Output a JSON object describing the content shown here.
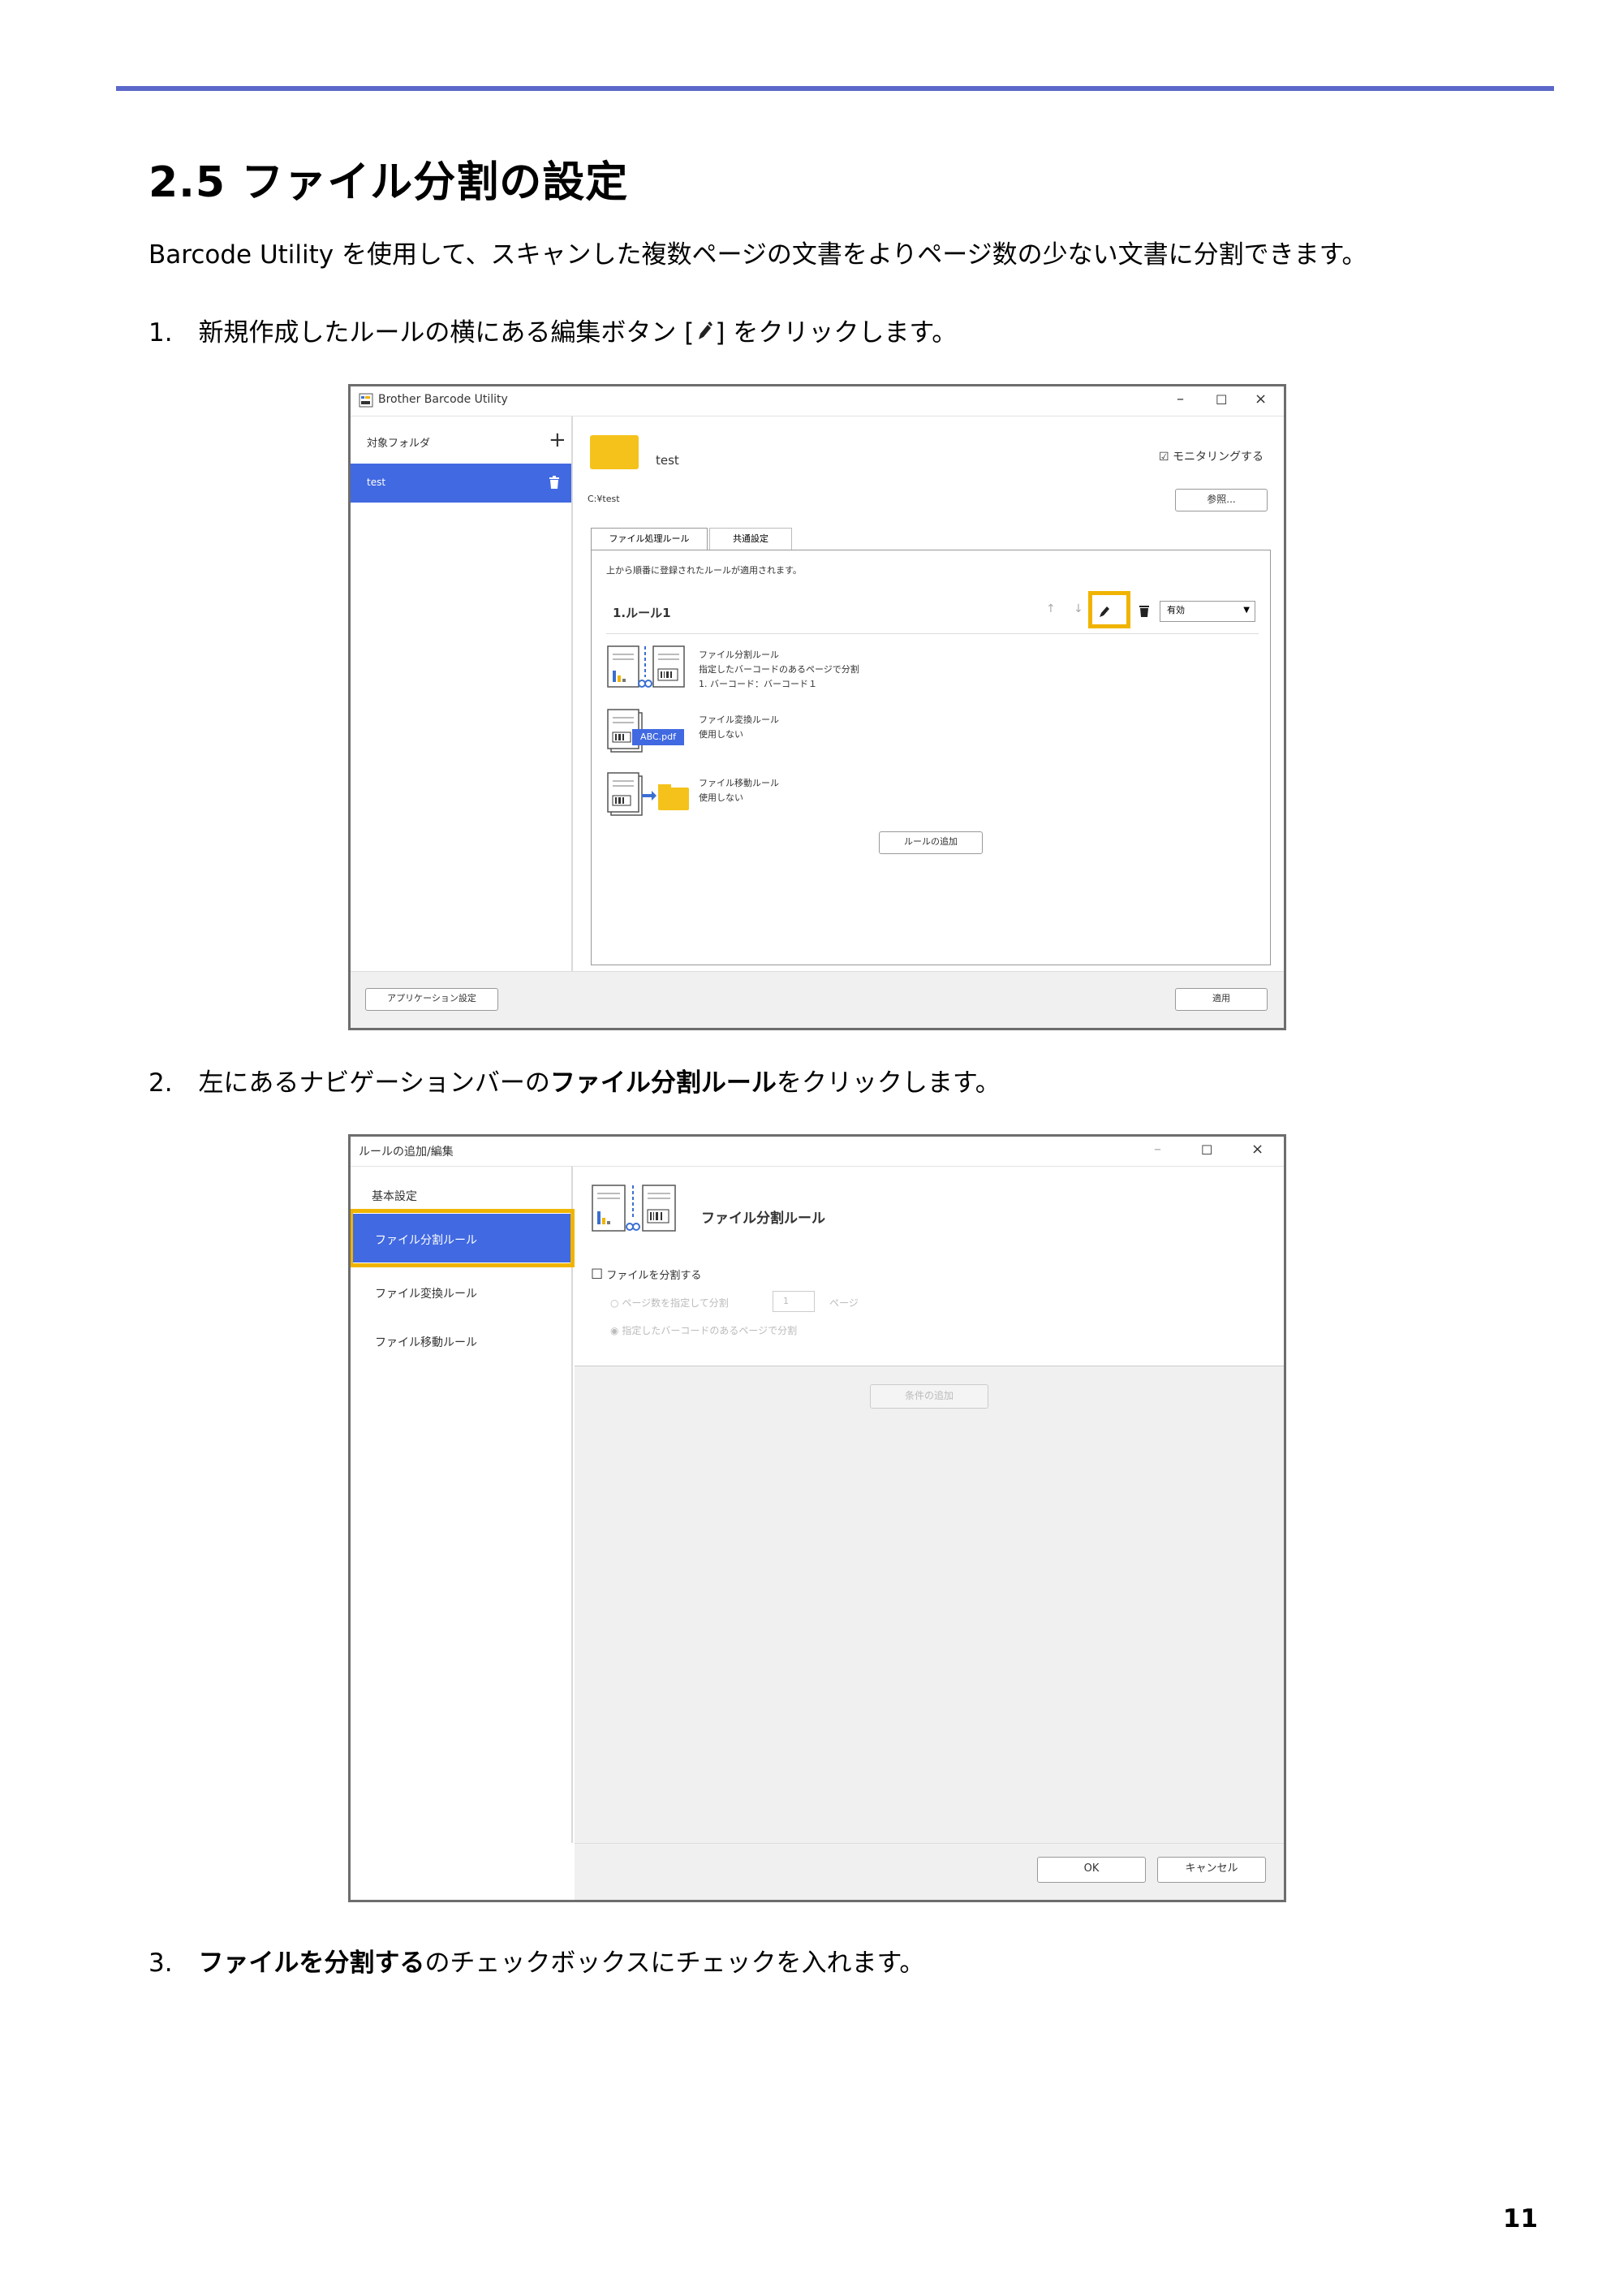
{
  "doc": {
    "section_title": "2.5 ファイル分割の設定",
    "intro": "Barcode Utility を使用して、スキャンした複数ページの文書をよりページ数の少ない文書に分割できます。",
    "step1_num": "1.",
    "step1_pre": "新規作成したルールの横にある編集ボタン [",
    "step1_post": "] をクリックします。",
    "step2_num": "2.",
    "step2_pre": "左にあるナビゲーションバーの",
    "step2_bold": "ファイル分割ルール",
    "step2_post": "をクリックします。",
    "step3_num": "3.",
    "step3_bold": "ファイルを分割する",
    "step3_post": "のチェックボックスにチェックを入れます。",
    "page_number": "11"
  },
  "shot1": {
    "window_title": "Brother Barcode Utility",
    "sidebar_header": "対象フォルダ",
    "add_symbol": "+",
    "folder_item": "test",
    "folder_name": "test",
    "folder_path": "C:¥test",
    "monitoring_label": "モニタリングする",
    "browse_button": "参照...",
    "tab_rules": "ファイル処理ルール",
    "tab_common": "共通設定",
    "rules_hint": "上から順番に登録されたルールが適用されます。",
    "rule_name": "1.ルール1",
    "status_value": "有効",
    "split_rule_title": "ファイル分割ルール",
    "split_rule_line1": "指定したバーコードのあるページで分割",
    "split_rule_line2": "1. バーコード：バーコード１",
    "convert_rule_title": "ファイル変換ルール",
    "convert_rule_value": "使用しない",
    "convert_badge": "ABC.pdf",
    "move_rule_title": "ファイル移動ルール",
    "move_rule_value": "使用しない",
    "add_rule_button": "ルールの追加",
    "app_settings_button": "アプリケーション設定",
    "apply_button": "適用"
  },
  "shot2": {
    "window_title": "ルールの追加/編集",
    "nav_basic": "基本設定",
    "nav_split": "ファイル分割ルール",
    "nav_convert": "ファイル変換ルール",
    "nav_move": "ファイル移動ルール",
    "header_title": "ファイル分割ルール",
    "split_checkbox_label": "ファイルを分割する",
    "option_pages_pre": "ページ数を指定して分割",
    "option_pages_value": "1",
    "option_pages_unit": "ページ",
    "option_barcode": "指定したバーコードのあるページで分割",
    "add_condition_button": "条件の追加",
    "ok_button": "OK",
    "cancel_button": "キャンセル"
  },
  "colors": {
    "accent_line": "#5b67c9",
    "selection_blue": "#4169e1",
    "highlight": "#f0b400",
    "folder": "#f5c21b"
  }
}
